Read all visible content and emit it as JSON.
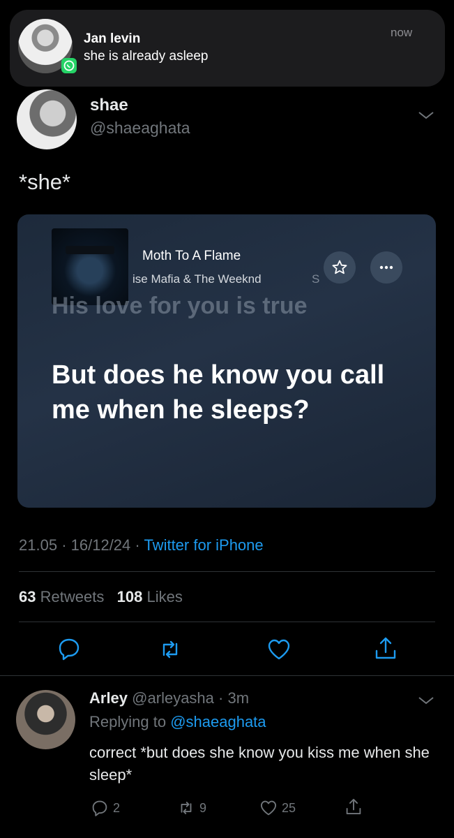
{
  "notification": {
    "sender": "Jan levin",
    "message": "she is already asleep",
    "time": "now",
    "app_icon": "whatsapp-icon"
  },
  "tweet": {
    "author_name": "shae",
    "author_handle": "@shaeaghata",
    "text": "*she*",
    "lyric_card": {
      "song_title": "Moth To A Flame",
      "artist": "ise Mafia & The Weeknd",
      "ghost_letter": "S",
      "faded_line": "His love for you is true",
      "lyric": "But does he know you call me when he sleeps?"
    },
    "time": "21.05",
    "date": "16/12/24",
    "source": "Twitter for iPhone",
    "retweets_count": "63",
    "retweets_label": "Retweets",
    "likes_count": "108",
    "likes_label": "Likes"
  },
  "reply": {
    "author_name": "Arley",
    "author_handle": "@arleyasha",
    "age": "3m",
    "replying_to_label": "Replying to",
    "replying_to_handle": "@shaeaghata",
    "text": "correct *but does she know you kiss me when she sleep*",
    "reply_count": "2",
    "retweet_count": "9",
    "like_count": "25"
  },
  "colors": {
    "background": "#000000",
    "link_blue": "#1d9bf0",
    "secondary_text": "#71767b",
    "card_bg": "#1f2c3e"
  }
}
